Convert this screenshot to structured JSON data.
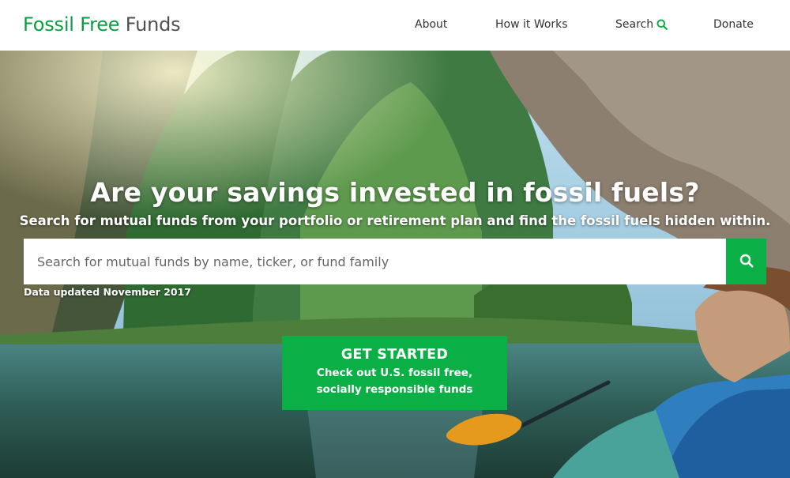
{
  "header": {
    "logo_part1": "Fossil Free",
    "logo_part2": "Funds",
    "nav": {
      "about": "About",
      "how_it_works": "How it Works",
      "search": "Search",
      "donate": "Donate"
    }
  },
  "hero": {
    "headline": "Are your savings invested in fossil fuels?",
    "subhead": "Search for mutual funds from your portfolio or retirement plan and find the fossil fuels hidden within.",
    "search": {
      "placeholder": "Search for mutual funds by name, ticker, or fund family",
      "value": ""
    },
    "updated": "Data updated November 2017",
    "cta": {
      "title": "GET STARTED",
      "line1": "Check out U.S. fossil free,",
      "line2": "socially responsible funds"
    }
  },
  "colors": {
    "brand_green": "#0a9e3f",
    "button_green": "#0ab045",
    "logo_gray": "#4f4f4f"
  },
  "icons": [
    "search-icon"
  ]
}
